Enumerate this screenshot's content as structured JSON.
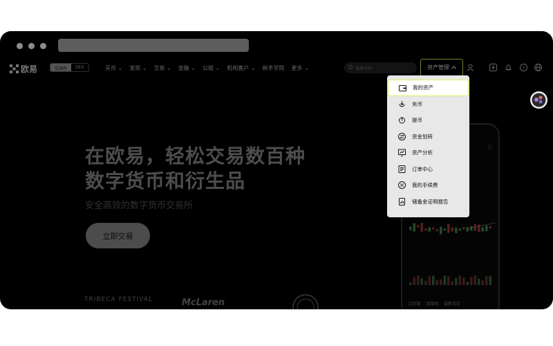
{
  "nav": {
    "logo": "欧易",
    "segments": [
      "交易所",
      "DEX"
    ],
    "menu": [
      "买币 ⌄",
      "发现 ⌄",
      "交易 ⌄",
      "金融 ⌄",
      "公链 ⌄",
      "机构客户 ⌄",
      "新手学院",
      "更多 ⌄"
    ],
    "search_placeholder": "搜索币种",
    "asset_button": "资产管理"
  },
  "dropdown": {
    "items": [
      "我的资产",
      "充币",
      "提币",
      "资金划转",
      "资产分析",
      "订单中心",
      "我的手续费",
      "储备金证明报告"
    ]
  },
  "hero": {
    "title_line1": "在欧易，轻松交易数百种",
    "title_line2": "数字货币和衍生品",
    "subtitle": "安全高效的数字货币交易所",
    "cta": "立即交易"
  },
  "partners": [
    "TRIBECA FESTIVAL",
    "McLaren"
  ],
  "phone": {
    "bottom_tabs": [
      "订单簿",
      "深度图",
      "最新成交"
    ]
  },
  "colors": {
    "accent": "#d4f25a",
    "background": "#000000",
    "dropdown_bg": "#e8e8e8"
  }
}
